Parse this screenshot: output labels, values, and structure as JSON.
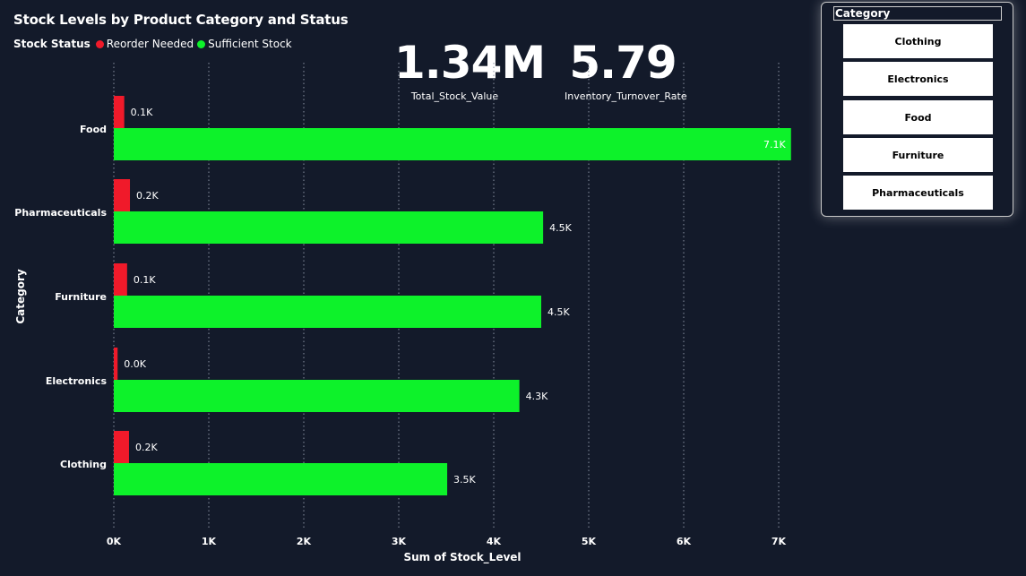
{
  "title": "Stock Levels by Product Category and Status",
  "legend": {
    "title": "Stock Status",
    "items": [
      {
        "label": "Reorder Needed",
        "color": "#f01a2a"
      },
      {
        "label": "Sufficient Stock",
        "color": "#0df22a"
      }
    ]
  },
  "kpis": {
    "total_stock_value": {
      "value": "1.34M",
      "label": "Total_Stock_Value"
    },
    "inventory_turnover_rate": {
      "value": "5.79",
      "label": "Inventory_Turnover_Rate"
    }
  },
  "slicer": {
    "title": "Category",
    "items": [
      "Clothing",
      "Electronics",
      "Food",
      "Furniture",
      "Pharmaceuticals"
    ]
  },
  "chart_data": {
    "type": "bar",
    "orientation": "horizontal",
    "title": "Stock Levels by Product Category and Status",
    "xlabel": "Sum of Stock_Level",
    "ylabel": "Category",
    "xlim": [
      0,
      7000
    ],
    "xticks": [
      0,
      1000,
      2000,
      3000,
      4000,
      5000,
      6000,
      7000
    ],
    "xtick_labels": [
      "0K",
      "1K",
      "2K",
      "3K",
      "4K",
      "5K",
      "6K",
      "7K"
    ],
    "categories": [
      "Food",
      "Pharmaceuticals",
      "Furniture",
      "Electronics",
      "Clothing"
    ],
    "series": [
      {
        "name": "Reorder Needed",
        "color": "#f01a2a",
        "values": [
          110,
          170,
          140,
          40,
          160
        ],
        "labels": [
          "0.1K",
          "0.2K",
          "0.1K",
          "0.0K",
          "0.2K"
        ]
      },
      {
        "name": "Sufficient Stock",
        "color": "#0df22a",
        "values": [
          7130,
          4520,
          4500,
          4270,
          3510
        ],
        "labels": [
          "7.1K",
          "4.5K",
          "4.5K",
          "4.3K",
          "3.5K"
        ]
      }
    ],
    "grid": "vertical-dotted"
  }
}
